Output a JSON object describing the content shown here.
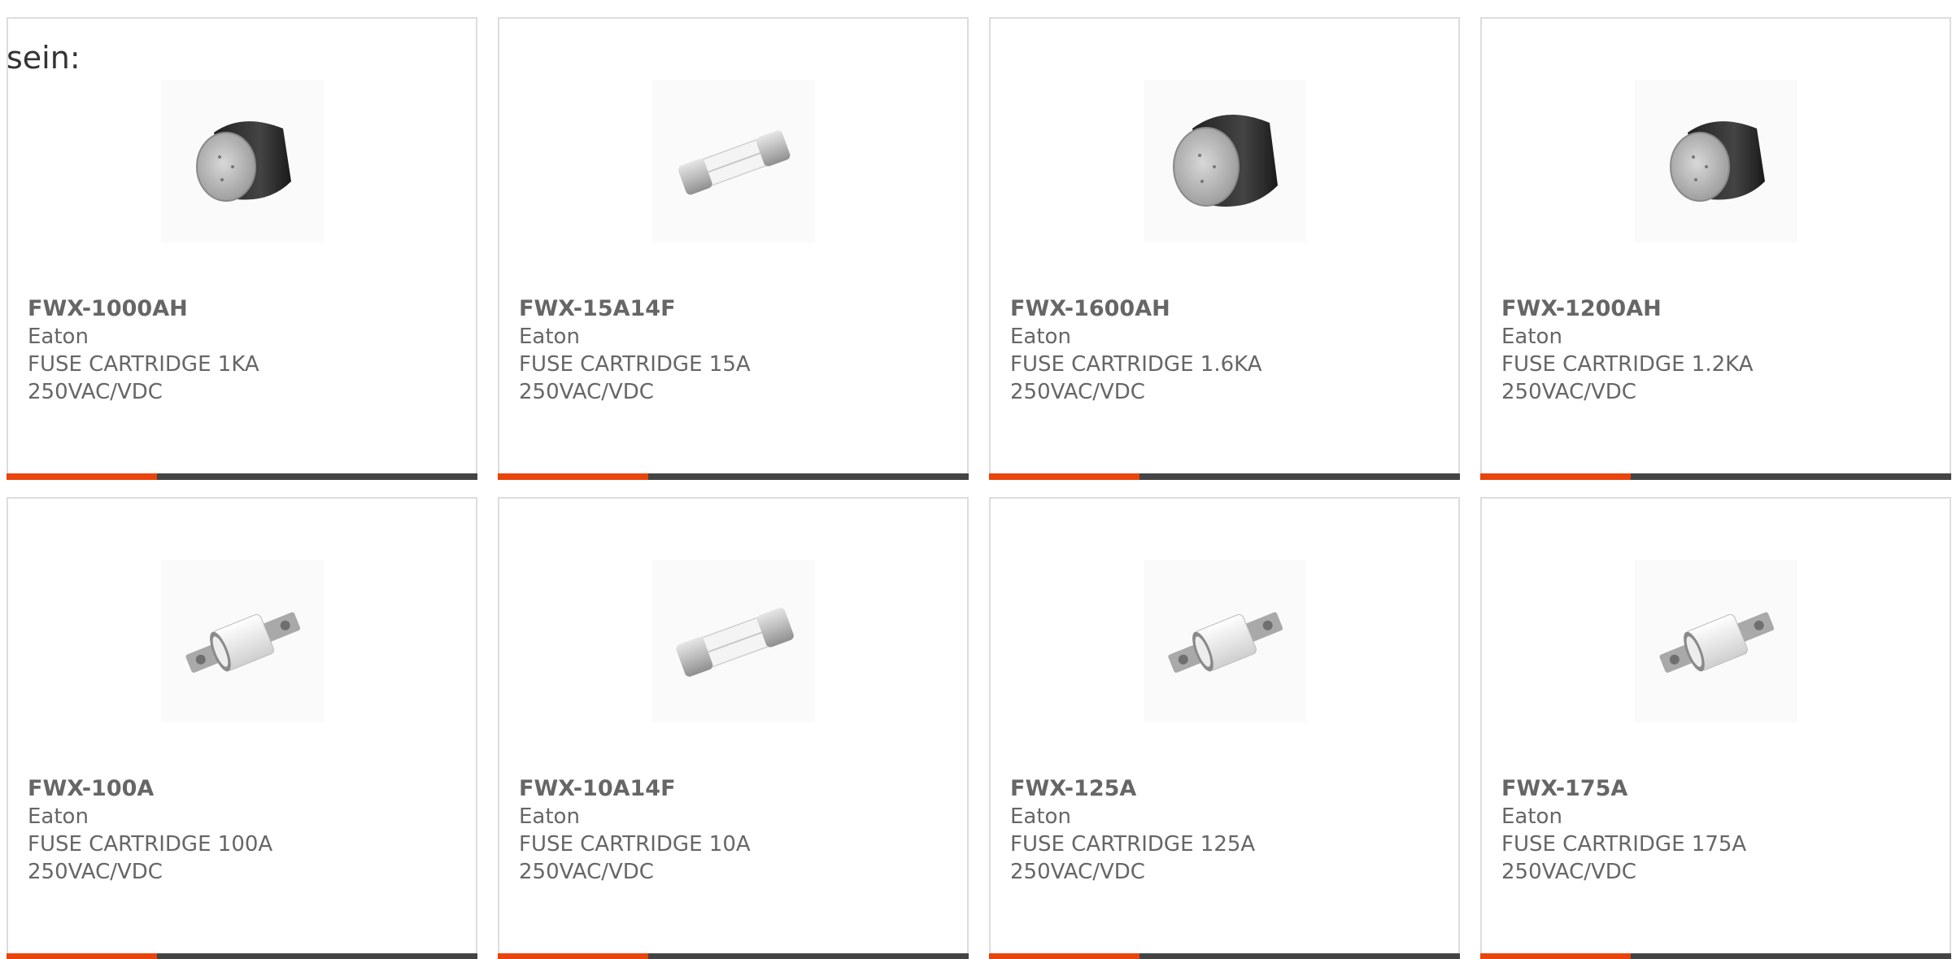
{
  "intro_text": "sein:",
  "colors": {
    "accent": "#e8440c",
    "bar": "#444444",
    "text": "#666666",
    "border": "#dddddd"
  },
  "products": [
    {
      "part": "FWX-1000AH",
      "brand": "Eaton",
      "desc": "FUSE CARTRIDGE 1KA",
      "rating": "250VAC/VDC",
      "icon": "round-fuse-icon"
    },
    {
      "part": "FWX-15A14F",
      "brand": "Eaton",
      "desc": "FUSE CARTRIDGE 15A",
      "rating": "250VAC/VDC",
      "icon": "glass-tube-fuse-icon"
    },
    {
      "part": "FWX-1600AH",
      "brand": "Eaton",
      "desc": "FUSE CARTRIDGE 1.6KA",
      "rating": "250VAC/VDC",
      "icon": "round-fuse-icon"
    },
    {
      "part": "FWX-1200AH",
      "brand": "Eaton",
      "desc": "FUSE CARTRIDGE 1.2KA",
      "rating": "250VAC/VDC",
      "icon": "round-fuse-icon"
    },
    {
      "part": "FWX-100A",
      "brand": "Eaton",
      "desc": "FUSE CARTRIDGE 100A",
      "rating": "250VAC/VDC",
      "icon": "bolt-fuse-icon"
    },
    {
      "part": "FWX-10A14F",
      "brand": "Eaton",
      "desc": "FUSE CARTRIDGE 10A",
      "rating": "250VAC/VDC",
      "icon": "glass-tube-fuse-icon"
    },
    {
      "part": "FWX-125A",
      "brand": "Eaton",
      "desc": "FUSE CARTRIDGE 125A",
      "rating": "250VAC/VDC",
      "icon": "bolt-fuse-icon"
    },
    {
      "part": "FWX-175A",
      "brand": "Eaton",
      "desc": "FUSE CARTRIDGE 175A",
      "rating": "250VAC/VDC",
      "icon": "bolt-fuse-icon"
    }
  ]
}
